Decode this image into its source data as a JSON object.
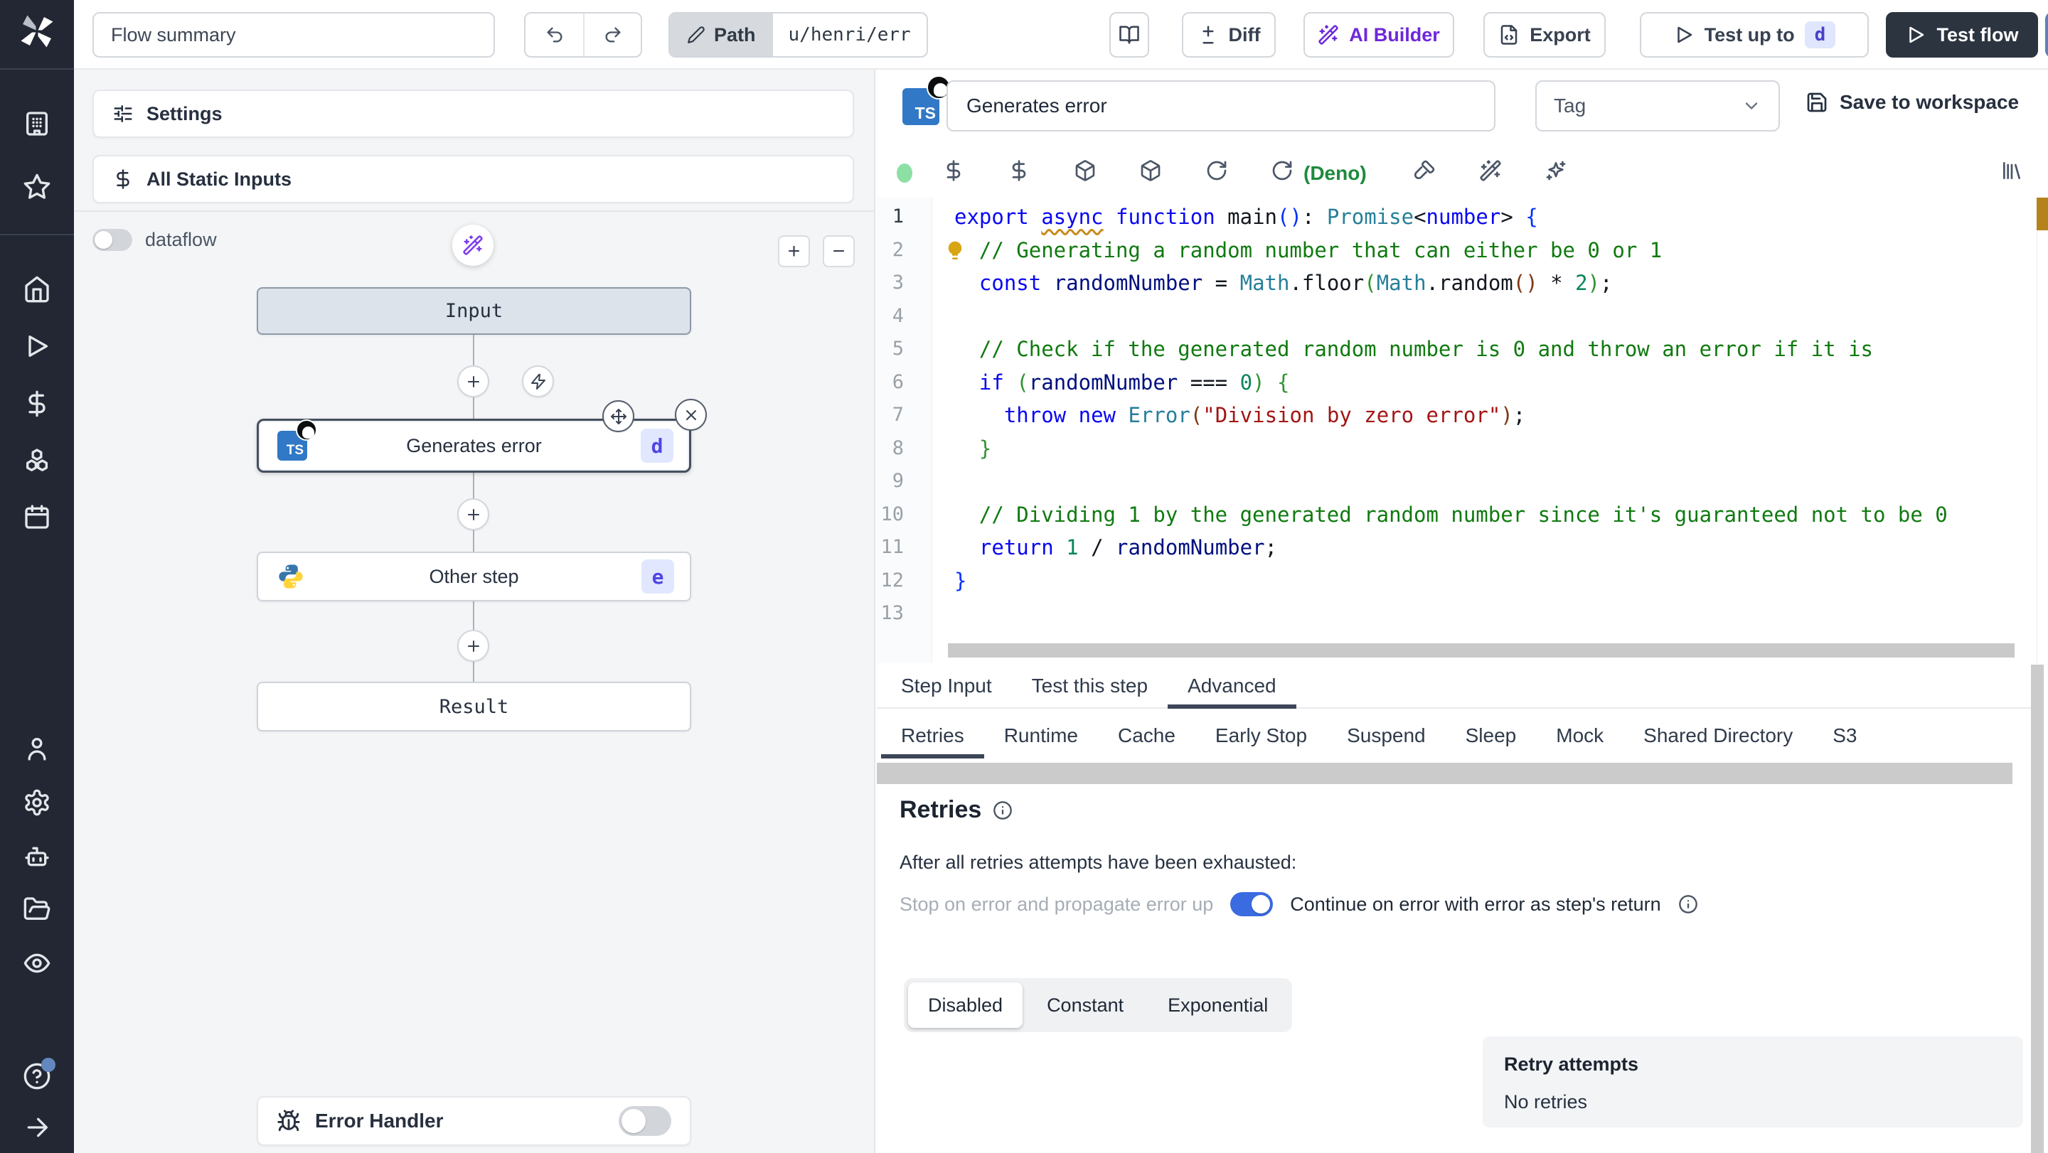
{
  "topbar": {
    "flow_summary": "Flow summary",
    "path_label": "Path",
    "path_value": "u/henri/err",
    "diff": "Diff",
    "ai_builder": "AI Builder",
    "export": "Export",
    "test_up_to": "Test up to",
    "test_up_to_badge": "d",
    "test_flow": "Test flow"
  },
  "left": {
    "settings": "Settings",
    "all_static_inputs": "All Static Inputs",
    "dataflow": "dataflow",
    "zoom_in": "+",
    "zoom_out": "−",
    "error_handler": "Error Handler",
    "nodes": {
      "input": "Input",
      "step1": {
        "label": "Generates error",
        "badge": "d"
      },
      "step2": {
        "label": "Other step",
        "badge": "e"
      },
      "result": "Result"
    }
  },
  "editor": {
    "ts_badge": "TS",
    "step_name": "Generates error",
    "tag_placeholder": "Tag",
    "save": "Save to workspace",
    "lang": "(Deno)",
    "code": {
      "lines": [
        {
          "n": 1,
          "segs": [
            [
              "export ",
              "k"
            ],
            [
              "async",
              "k sq"
            ],
            [
              " ",
              "pl"
            ],
            [
              "function",
              "k"
            ],
            [
              " ",
              "pl"
            ],
            [
              "main",
              "pl"
            ],
            [
              "(",
              "b1"
            ],
            [
              ")",
              "b1"
            ],
            [
              ": ",
              "pl"
            ],
            [
              "Promise",
              "ty"
            ],
            [
              "<",
              "pl"
            ],
            [
              "number",
              "k"
            ],
            [
              ">",
              "pl"
            ],
            [
              " ",
              "pl"
            ],
            [
              "{",
              "b1"
            ]
          ]
        },
        {
          "n": 2,
          "bulb": true,
          "segs": [
            [
              "  ",
              "pl"
            ],
            [
              "// Generating a random number that can either be 0 or 1",
              "cmt"
            ]
          ]
        },
        {
          "n": 3,
          "segs": [
            [
              "  ",
              "pl"
            ],
            [
              "const",
              "k"
            ],
            [
              " ",
              "pl"
            ],
            [
              "randomNumber",
              "vr"
            ],
            [
              " = ",
              "pl"
            ],
            [
              "Math",
              "ty"
            ],
            [
              ".floor",
              "pl"
            ],
            [
              "(",
              "b2"
            ],
            [
              "Math",
              "ty"
            ],
            [
              ".random",
              "pl"
            ],
            [
              "(",
              "b3"
            ],
            [
              ")",
              "b3"
            ],
            [
              " * ",
              "pl"
            ],
            [
              "2",
              "num"
            ],
            [
              ")",
              "b2"
            ],
            [
              ";",
              "pl"
            ]
          ]
        },
        {
          "n": 4,
          "segs": []
        },
        {
          "n": 5,
          "segs": [
            [
              "  ",
              "pl"
            ],
            [
              "// Check if the generated random number is 0 and throw an error if it is",
              "cmt"
            ]
          ]
        },
        {
          "n": 6,
          "segs": [
            [
              "  ",
              "pl"
            ],
            [
              "if",
              "k"
            ],
            [
              " ",
              "pl"
            ],
            [
              "(",
              "b2"
            ],
            [
              "randomNumber",
              "vr"
            ],
            [
              " === ",
              "pl"
            ],
            [
              "0",
              "num"
            ],
            [
              ")",
              "b2"
            ],
            [
              " ",
              "pl"
            ],
            [
              "{",
              "b2"
            ]
          ]
        },
        {
          "n": 7,
          "segs": [
            [
              "    ",
              "pl"
            ],
            [
              "throw",
              "k"
            ],
            [
              " ",
              "pl"
            ],
            [
              "new",
              "k"
            ],
            [
              " ",
              "pl"
            ],
            [
              "Error",
              "ty"
            ],
            [
              "(",
              "b3"
            ],
            [
              "\"Division by zero error\"",
              "str"
            ],
            [
              ")",
              "b3"
            ],
            [
              ";",
              "pl"
            ]
          ]
        },
        {
          "n": 8,
          "segs": [
            [
              "  ",
              "pl"
            ],
            [
              "}",
              "b2"
            ]
          ]
        },
        {
          "n": 9,
          "segs": []
        },
        {
          "n": 10,
          "segs": [
            [
              "  ",
              "pl"
            ],
            [
              "// Dividing 1 by the generated random number since it's guaranteed not to be 0",
              "cmt"
            ]
          ]
        },
        {
          "n": 11,
          "segs": [
            [
              "  ",
              "pl"
            ],
            [
              "return",
              "k"
            ],
            [
              " ",
              "pl"
            ],
            [
              "1",
              "num"
            ],
            [
              " / ",
              "pl"
            ],
            [
              "randomNumber",
              "vr"
            ],
            [
              ";",
              "pl"
            ]
          ]
        },
        {
          "n": 12,
          "segs": [
            [
              "}",
              "b1"
            ]
          ]
        },
        {
          "n": 13,
          "segs": []
        }
      ]
    }
  },
  "tabs": {
    "items": [
      "Step Input",
      "Test this step",
      "Advanced"
    ],
    "active": "Advanced"
  },
  "subtabs": {
    "items": [
      "Retries",
      "Runtime",
      "Cache",
      "Early Stop",
      "Suspend",
      "Sleep",
      "Mock",
      "Shared Directory",
      "S3"
    ],
    "active": "Retries"
  },
  "retries": {
    "title": "Retries",
    "exhausted": "After all retries attempts have been exhausted:",
    "stop_label": "Stop on error and propagate error up",
    "continue_label": "Continue on error with error as step's return",
    "modes": [
      "Disabled",
      "Constant",
      "Exponential"
    ],
    "active_mode": "Disabled",
    "retry_attempts_title": "Retry attempts",
    "retry_attempts_value": "No retries"
  },
  "colors": {
    "accent_blue": "#3b6be1",
    "indigo_badge_bg": "#e1e7fe",
    "indigo_badge_text": "#4f46e5",
    "purple": "#7c3aed",
    "deno_green": "#1d8a3c",
    "dark_button": "#2c3440",
    "ruler_marker": "#b5831c"
  }
}
